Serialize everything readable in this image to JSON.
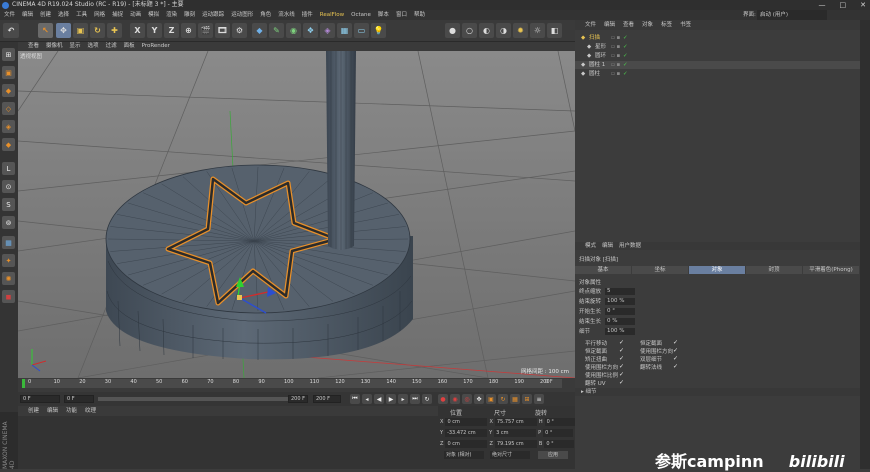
{
  "window": {
    "title": "CINEMA 4D R19.024 Studio (RC - R19) - [未标题 3 *] - 主要",
    "controls": [
      "—",
      "□",
      "✕"
    ]
  },
  "menubar": {
    "items": [
      "文件",
      "编辑",
      "创建",
      "选择",
      "工具",
      "网格",
      "捕捉",
      "动画",
      "模拟",
      "渲染",
      "雕刻",
      "运动跟踪",
      "运动图形",
      "角色",
      "流水线",
      "插件",
      "RealFlow",
      "Octane",
      "脚本",
      "窗口",
      "帮助"
    ],
    "highlight": "RealFlow"
  },
  "layout": {
    "label": "界面:",
    "value": "启动 (用户)"
  },
  "viewport_menu": [
    "查看",
    "摄像机",
    "显示",
    "选项",
    "过滤",
    "面板",
    "ProRender"
  ],
  "viewport": {
    "label": "透视视图",
    "grid_info": "网格间距 : 100 cm"
  },
  "toolbar_axes": [
    "X",
    "Y",
    "Z"
  ],
  "timeline": {
    "ticks": [
      "0",
      "10",
      "20",
      "30",
      "40",
      "50",
      "60",
      "70",
      "80",
      "90",
      "100",
      "110",
      "120",
      "130",
      "140",
      "150",
      "160",
      "170",
      "180",
      "190",
      "200"
    ],
    "frame_end": "0 F"
  },
  "playbar": {
    "current": "0 F",
    "start": "0 F",
    "range_end": "200 F",
    "end": "200 F"
  },
  "bottom_menu": [
    "创建",
    "编辑",
    "功能",
    "纹理"
  ],
  "brand": "MAXON CINEMA 4D",
  "coords": {
    "headers": [
      "位置",
      "尺寸",
      "旋转"
    ],
    "rows": [
      {
        "axis": "X",
        "pos": "0 cm",
        "size_axis": "X",
        "size": "75.757 cm",
        "rot_axis": "H",
        "rot": "0 °"
      },
      {
        "axis": "Y",
        "pos": "-33.472 cm",
        "size_axis": "Y",
        "size": "3 cm",
        "rot_axis": "P",
        "rot": "0 °"
      },
      {
        "axis": "Z",
        "pos": "0 cm",
        "size_axis": "Z",
        "size": "79.195 cm",
        "rot_axis": "B",
        "rot": "0 °"
      }
    ],
    "mode1": "对象 (相对)",
    "mode2": "绝对尺寸",
    "apply": "应用"
  },
  "objects": {
    "menu": [
      "文件",
      "编辑",
      "查看",
      "对象",
      "标签",
      "书签"
    ],
    "items": [
      {
        "name": "扫描",
        "indent": 1,
        "color": "#e8c452"
      },
      {
        "name": "星形",
        "indent": 2,
        "color": "#c8c8c8"
      },
      {
        "name": "圆环",
        "indent": 2,
        "color": "#c8c8c8"
      },
      {
        "name": "圆柱 1",
        "indent": 1,
        "color": "#c8c8c8"
      },
      {
        "name": "圆柱",
        "indent": 1,
        "color": "#c8c8c8"
      }
    ]
  },
  "attributes": {
    "menu": [
      "模式",
      "编辑",
      "用户数据"
    ],
    "object_title": "扫描对象 [扫描]",
    "tabs": [
      "基本",
      "坐标",
      "对象",
      "封顶",
      "平滑着色(Phong)"
    ],
    "active_tab": "对象",
    "section": "对象属性",
    "params": [
      {
        "label": "终点缩放",
        "value": "5"
      },
      {
        "label": "结束旋转",
        "value": "100 %"
      },
      {
        "label": "开始生长",
        "value": "0 °"
      },
      {
        "label": "结束生长",
        "value": "0 %"
      },
      {
        "label": "细节",
        "value": "100 %"
      }
    ],
    "checks_left": [
      "平行移动",
      "恒定截面",
      "矫正扭曲",
      "使用围栏方向",
      "使用围栏比例",
      "翻转 UV"
    ],
    "checks_right": [
      "恒定截面",
      "使用围栏方向",
      "双层细节",
      "翻转法线"
    ],
    "collapse": "细节"
  },
  "watermark": {
    "text": "参斯campinn",
    "brand": "bilibili"
  },
  "colors": {
    "accent": "#e8c452",
    "spline": "#e8902a",
    "mesh": "#4f5a66",
    "viewport_bg": "#7b7b7b"
  }
}
